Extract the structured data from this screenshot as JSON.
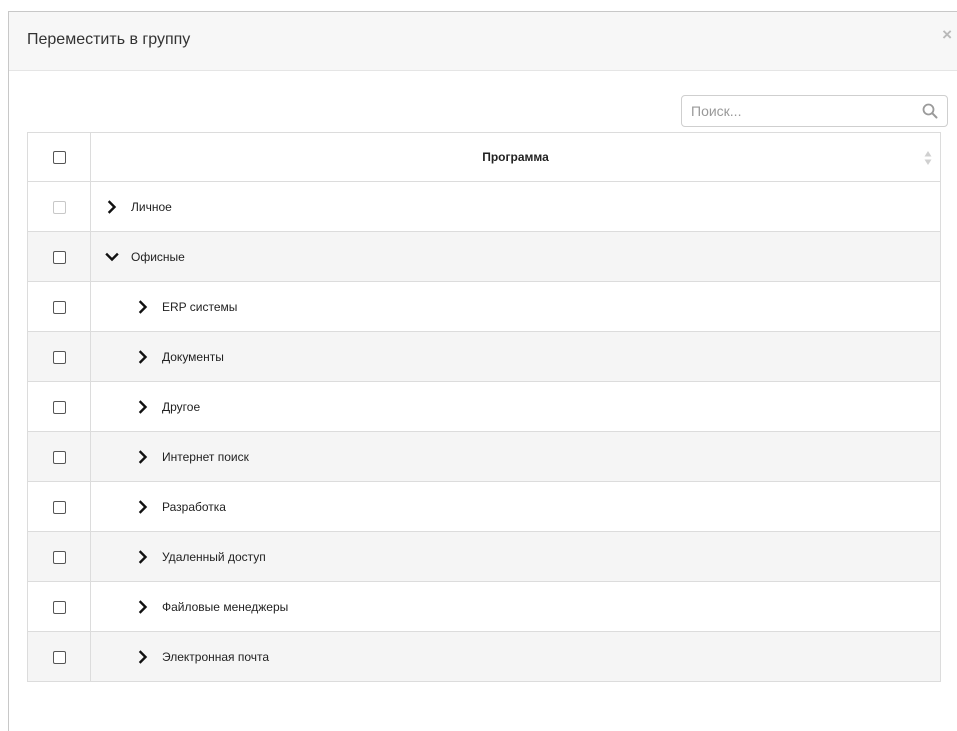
{
  "dialog": {
    "title": "Переместить в группу",
    "close_glyph": "×"
  },
  "search": {
    "placeholder": "Поиск...",
    "value": "",
    "icon": "search-icon"
  },
  "table": {
    "columns": [
      "Программа"
    ],
    "sort_icon": "sort-icon",
    "rows": [
      {
        "label": "Личное",
        "level": 0,
        "expanded": false,
        "checkbox_disabled": true
      },
      {
        "label": "Офисные",
        "level": 0,
        "expanded": true,
        "checkbox_disabled": false
      },
      {
        "label": "ERP системы",
        "level": 1,
        "expanded": false,
        "checkbox_disabled": false
      },
      {
        "label": "Документы",
        "level": 1,
        "expanded": false,
        "checkbox_disabled": false
      },
      {
        "label": "Другое",
        "level": 1,
        "expanded": false,
        "checkbox_disabled": false
      },
      {
        "label": "Интернет поиск",
        "level": 1,
        "expanded": false,
        "checkbox_disabled": false
      },
      {
        "label": "Разработка",
        "level": 1,
        "expanded": false,
        "checkbox_disabled": false
      },
      {
        "label": "Удаленный доступ",
        "level": 1,
        "expanded": false,
        "checkbox_disabled": false
      },
      {
        "label": "Файловые менеджеры",
        "level": 1,
        "expanded": false,
        "checkbox_disabled": false
      },
      {
        "label": "Электронная почта",
        "level": 1,
        "expanded": false,
        "checkbox_disabled": false
      }
    ]
  },
  "colors": {
    "header_bg": "#f7f7f7",
    "stripe_bg": "#f5f5f5",
    "border": "#dcdcdc",
    "close": "#b9b9b9"
  }
}
